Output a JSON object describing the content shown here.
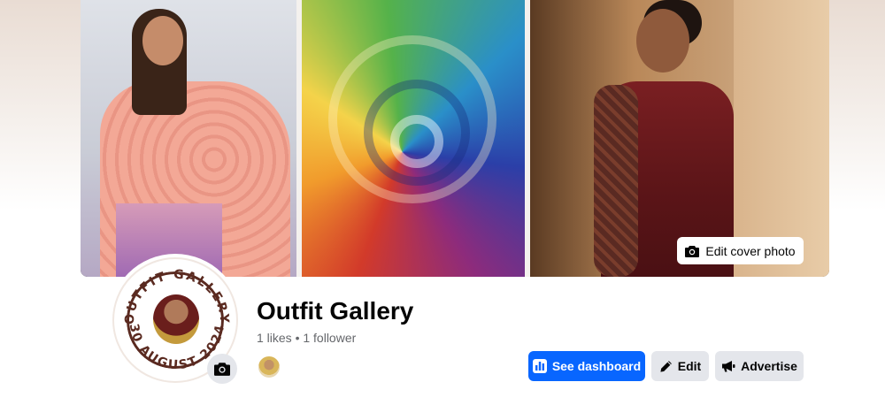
{
  "cover": {
    "edit_cover_label": "Edit cover photo"
  },
  "profile": {
    "page_name": "Outfit Gallery",
    "stats": "1 likes • 1 follower",
    "logo_text_top": "OUTFIT GALLERY",
    "logo_text_bottom": "30 AUGUST 2024"
  },
  "actions": {
    "dashboard_label": "See dashboard",
    "edit_label": "Edit",
    "advertise_label": "Advertise"
  },
  "icons": {
    "edit_cover": "camera-icon",
    "avatar_camera": "camera-icon",
    "dashboard": "bar-chart-icon",
    "edit": "pencil-icon",
    "advertise": "megaphone-icon"
  },
  "colors": {
    "primary_button": "#0866ff",
    "secondary_button": "#e4e6eb",
    "text_primary": "#050505",
    "text_secondary": "#65676b"
  }
}
